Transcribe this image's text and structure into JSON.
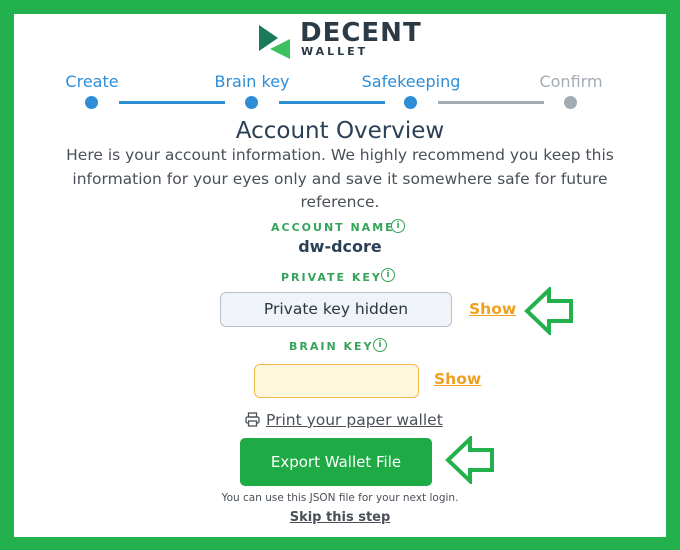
{
  "colors": {
    "frame": "#22b14c",
    "accent_blue": "#2d8ed6",
    "inactive_gray": "#a3abb3",
    "label_green": "#35a35a",
    "link_orange": "#f0a020",
    "button_green": "#1eaa44"
  },
  "logo": {
    "brand": "DECENT",
    "sub": "WALLET"
  },
  "stepper": {
    "steps": [
      {
        "label": "Create",
        "state": "done"
      },
      {
        "label": "Brain key",
        "state": "done"
      },
      {
        "label": "Safekeeping",
        "state": "current"
      },
      {
        "label": "Confirm",
        "state": "pending"
      }
    ]
  },
  "page": {
    "title": "Account Overview",
    "intro": "Here is your account information. We highly recommend you keep this information for your eyes only and save it somewhere safe for future reference."
  },
  "account": {
    "label": "ACCOUNT NAME",
    "value": "dw-dcore",
    "info_icon": "info-icon"
  },
  "private_key": {
    "label": "PRIVATE KEY",
    "display": "Private key hidden",
    "show_label": "Show",
    "info_icon": "info-icon"
  },
  "brain_key": {
    "label": "BRAIN KEY",
    "value": "",
    "show_label": "Show",
    "info_icon": "info-icon"
  },
  "print": {
    "label": "Print your paper wallet",
    "icon": "printer-icon"
  },
  "export": {
    "button_label": "Export Wallet File",
    "hint": "You can use this JSON file for your next login."
  },
  "skip": {
    "label": "Skip this step"
  },
  "annotations": {
    "arrow_icon": "arrow-left-icon"
  }
}
